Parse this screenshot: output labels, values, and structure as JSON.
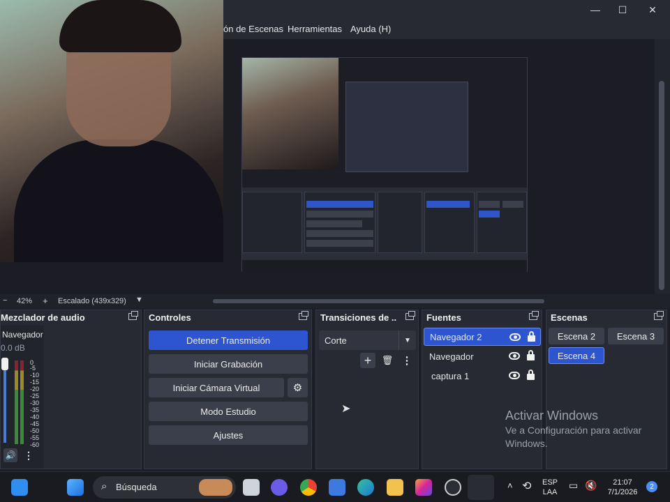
{
  "menu": {
    "items": [
      "ón de Escenas",
      "Herramientas",
      "Ayuda (H)"
    ]
  },
  "window_controls": {
    "minimize": "—",
    "maximize": "☐",
    "close": "✕"
  },
  "status": {
    "zoom": "42%",
    "scaling": "Escalado (439x329)"
  },
  "docks": {
    "audio": {
      "title": "Mezclador de audio",
      "channel_name": "Navegador",
      "level": "0.0 dB",
      "ticks": [
        "0",
        "-5",
        "-10",
        "-15",
        "-20",
        "-25",
        "-30",
        "-35",
        "-40",
        "-45",
        "-50",
        "-55",
        "-60"
      ]
    },
    "controls": {
      "title": "Controles",
      "stop_stream": "Detener Transmisión",
      "start_recording": "Iniciar Grabación",
      "start_virtual_cam": "Iniciar Cámara Virtual",
      "studio_mode": "Modo Estudio",
      "settings": "Ajustes"
    },
    "transitions": {
      "title": "Transiciones de ...",
      "selected": "Corte"
    },
    "sources": {
      "title": "Fuentes",
      "items": [
        "Navegador 2",
        "Navegador",
        "captura 1"
      ]
    },
    "scenes": {
      "title": "Escenas",
      "items": [
        "Escena 2",
        "Escena 3",
        "Escena 4"
      ]
    }
  },
  "watermark": {
    "line1": "Activar Windows",
    "line2": "Ve a Configuración para activar",
    "line3": "Windows."
  },
  "taskbar": {
    "search_label": "Búsqueda",
    "lang_top": "ESP",
    "lang_bottom": "LAA",
    "time": "21:07",
    "date": "7/1/2026",
    "notifications": "2"
  },
  "colors": {
    "accent": "#2d55d0",
    "panel": "#272a33",
    "background": "#1e1f26"
  }
}
